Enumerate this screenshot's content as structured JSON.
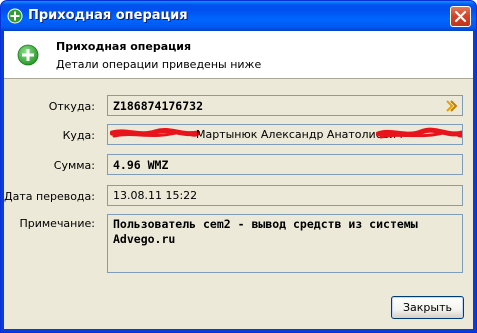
{
  "window": {
    "title": "Приходная операция"
  },
  "header": {
    "title": "Приходная операция",
    "subtitle": "Детали операции приведены ниже"
  },
  "fields": {
    "from_label": "Откуда:",
    "from_value": "Z186874176732",
    "to_label": "Куда:",
    "to_value": "Мартынюк Александр Анатолиевич",
    "amount_label": "Сумма:",
    "amount_value": "4.96 WMZ",
    "date_label": "Дата перевода:",
    "date_value": "13.08.11 15:22",
    "note_label": "Примечание:",
    "note_value": "Пользователь cem2 - вывод средств из системы Advego.ru"
  },
  "buttons": {
    "close_label": "Закрыть"
  },
  "colors": {
    "accent_green": "#3cae3c",
    "redaction_red": "#e8141c",
    "chevron_orange": "#e8a000"
  }
}
